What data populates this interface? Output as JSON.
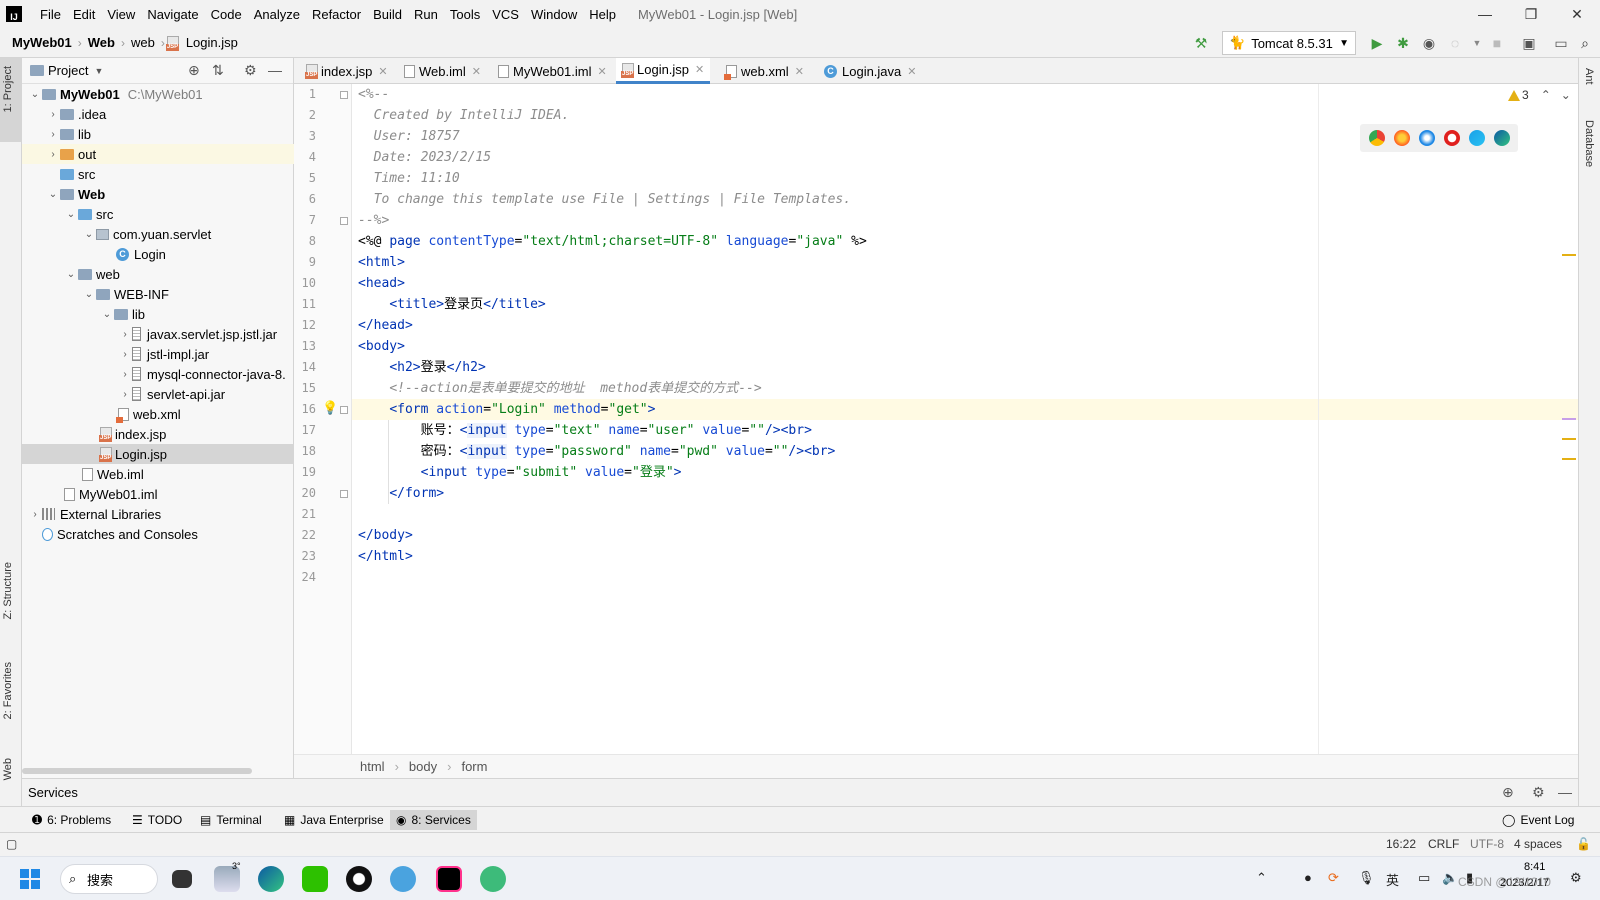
{
  "window": {
    "title": "MyWeb01 - Login.jsp [Web]",
    "logo_text": "IJ",
    "controls": {
      "minimize": "—",
      "maximize": "❐",
      "close": "✕"
    }
  },
  "menu": [
    "File",
    "Edit",
    "View",
    "Navigate",
    "Code",
    "Analyze",
    "Refactor",
    "Build",
    "Run",
    "Tools",
    "VCS",
    "Window",
    "Help"
  ],
  "navbar": {
    "crumbs": [
      "MyWeb01",
      "Web",
      "web",
      "Login.jsp"
    ],
    "run_config": "Tomcat 8.5.31"
  },
  "left_strip": {
    "project": "1: Project",
    "structure": "Z: Structure",
    "favorites": "2: Favorites",
    "web": "Web"
  },
  "right_strip": {
    "ant": "Ant",
    "database": "Database"
  },
  "project_panel": {
    "title": "Project",
    "tree": [
      {
        "label": "MyWeb01",
        "extra": "C:\\MyWeb01",
        "bold": true
      },
      {
        "label": ".idea"
      },
      {
        "label": "lib"
      },
      {
        "label": "out"
      },
      {
        "label": "src"
      },
      {
        "label": "Web",
        "bold": true
      },
      {
        "label": "src"
      },
      {
        "label": "com.yuan.servlet"
      },
      {
        "label": "Login"
      },
      {
        "label": "web"
      },
      {
        "label": "WEB-INF"
      },
      {
        "label": "lib"
      },
      {
        "label": "javax.servlet.jsp.jstl.jar"
      },
      {
        "label": "jstl-impl.jar"
      },
      {
        "label": "mysql-connector-java-8."
      },
      {
        "label": "servlet-api.jar"
      },
      {
        "label": "web.xml"
      },
      {
        "label": "index.jsp"
      },
      {
        "label": "Login.jsp"
      },
      {
        "label": "Web.iml"
      },
      {
        "label": "MyWeb01.iml"
      },
      {
        "label": "External Libraries"
      },
      {
        "label": "Scratches and Consoles"
      }
    ]
  },
  "tabs": [
    {
      "label": "index.jsp"
    },
    {
      "label": "Web.iml"
    },
    {
      "label": "MyWeb01.iml"
    },
    {
      "label": "Login.jsp",
      "active": true
    },
    {
      "label": "web.xml"
    },
    {
      "label": "Login.java"
    }
  ],
  "editor": {
    "line_numbers": [
      "1",
      "2",
      "3",
      "4",
      "5",
      "6",
      "7",
      "8",
      "9",
      "10",
      "11",
      "12",
      "13",
      "14",
      "15",
      "16",
      "17",
      "18",
      "19",
      "20",
      "21",
      "22",
      "23",
      "24"
    ],
    "lines": {
      "l1": "<%--",
      "l2": "  Created by IntelliJ IDEA.",
      "l3": "  User: 18757",
      "l4": "  Date: 2023/2/15",
      "l5": "  Time: 11:10",
      "l6": "  To change this template use File | Settings | File Templates.",
      "l7": "--%>",
      "l14_tag": "登录",
      "l11_title": "登录页",
      "l15": "<!--action是表单要提交的地址  method表单提交的方式-->",
      "l17_label": "账号：",
      "l18_label": "密码：",
      "l19_value": "登录"
    },
    "warnings": "3",
    "breadcrumbs": [
      "html",
      "body",
      "form"
    ]
  },
  "services_label": "Services",
  "toolwindows": [
    "6: Problems",
    "TODO",
    "Terminal",
    "Java Enterprise",
    "8: Services",
    "Event Log"
  ],
  "status": {
    "position": "16:22",
    "line_sep": "CRLF",
    "encoding": "UTF-8",
    "indent": "4 spaces"
  },
  "taskbar": {
    "search": "搜索",
    "weather": "3°",
    "ime": "英",
    "time": "8:41",
    "date": "2023/2/17",
    "watermark": "CSDN @19/1010"
  }
}
